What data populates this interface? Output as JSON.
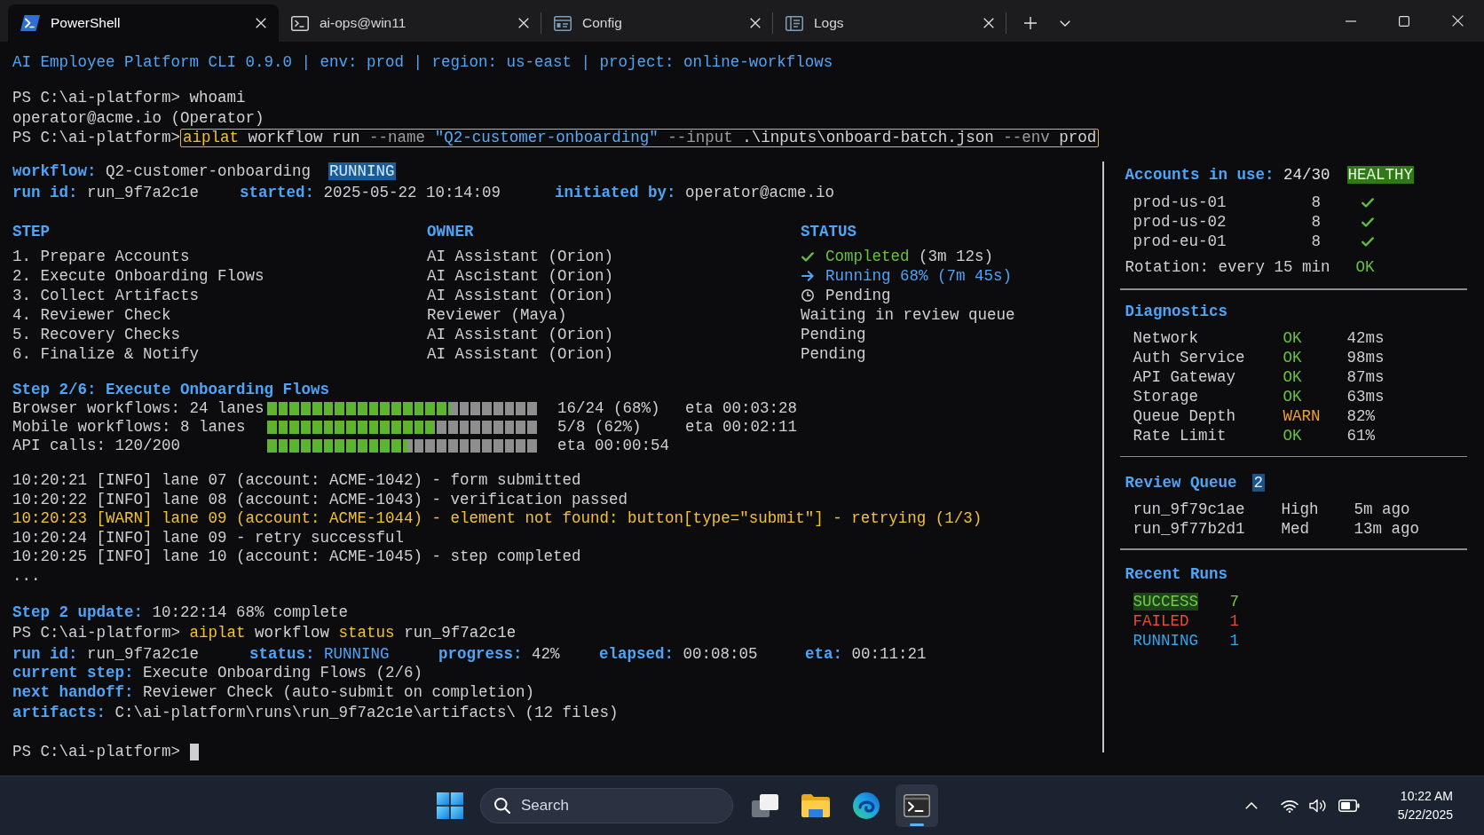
{
  "tabs": [
    {
      "label": "PowerShell",
      "selected": true
    },
    {
      "label": "ai-ops@win11",
      "selected": false
    },
    {
      "label": "Config",
      "selected": false
    },
    {
      "label": "Logs",
      "selected": false
    }
  ],
  "terminal": {
    "banner": "AI Employee Platform CLI 0.9.0 | env: prod | region: us-east | project: online-workflows",
    "history": [
      {
        "kind": "command",
        "prompt": "PS C:\\ai-platform>",
        "outlined": false,
        "tokens": [
          {
            "text": "whoami",
            "kind": "plain"
          }
        ]
      },
      {
        "kind": "output",
        "text": "operator@acme.io (Operator)"
      },
      {
        "kind": "command",
        "prompt": "PS C:\\ai-platform>",
        "outlined": true,
        "tokens": [
          {
            "text": "aiplat",
            "kind": "highlight"
          },
          {
            "text": "workflow run",
            "kind": "plain"
          },
          {
            "text": "--name",
            "kind": "flag"
          },
          {
            "text": "\"Q2-customer-onboarding\"",
            "kind": "string"
          },
          {
            "text": "--input",
            "kind": "flag"
          },
          {
            "text": ".\\inputs\\onboard-batch.json",
            "kind": "plain"
          },
          {
            "text": "--env",
            "kind": "flag"
          },
          {
            "text": "prod",
            "kind": "plain"
          }
        ]
      }
    ],
    "workflow": {
      "label": "workflow:",
      "value": "Q2-customer-onboarding",
      "status": "RUNNING"
    },
    "run_fields": [
      {
        "label": "run id:",
        "value": "run_9f7a2c1e"
      },
      {
        "label": "started:",
        "value": "2025-05-22 10:14:09"
      },
      {
        "label": "initiated by:",
        "value": "operator@acme.io"
      }
    ],
    "steps": {
      "columns": [
        "STEP",
        "OWNER",
        "STATUS"
      ],
      "rows": [
        {
          "step": "1. Prepare Accounts",
          "owner": "AI Assistant (Orion)",
          "status": "Completed",
          "detail": "(3m 12s)",
          "kind": "done"
        },
        {
          "step": "2. Execute Onboarding Flows",
          "owner": "AI Ascistant (Orion)",
          "status": "Running 68% (7m 45s)",
          "kind": "active"
        },
        {
          "step": "3. Collect Artifacts",
          "owner": "AI Assistant (Orion)",
          "status": "Pending",
          "kind": "next"
        },
        {
          "step": "4. Reviewer Check",
          "owner": "Reviewer (Maya)",
          "status": "Waiting in review queue",
          "kind": "queued"
        },
        {
          "step": "5. Recovery Checks",
          "owner": "AI Assistant (Orion)",
          "status": "Pending",
          "kind": "queued"
        },
        {
          "step": "6. Finalize & Notify",
          "owner": "AI Assistant (Orion)",
          "status": "Pending",
          "kind": "queued"
        }
      ]
    },
    "progress": {
      "title": "Step 2/6: Execute Onboarding Flows",
      "bars": [
        {
          "label": "Browser workflows: 24 lanes",
          "level": 0.68,
          "count": "16/24 (68%)",
          "eta": "eta 00:03:28"
        },
        {
          "label": "Mobile workflows: 8 lanes",
          "level": 0.62,
          "count": "5/8 (62%)",
          "eta": "eta 00:02:11"
        },
        {
          "label": "API calls: 120/200",
          "level": 0.52,
          "eta": "eta 00:00:54"
        }
      ]
    },
    "log": [
      {
        "text": "10:20:21 [INFO] lane 07 (account: ACME-1042) - form submitted",
        "kind": "info"
      },
      {
        "text": "10:20:22 [INFO] lane 08 (account: ACME-1043) - verification passed",
        "kind": "info"
      },
      {
        "text": "10:20:23 [WARN] lane 09 (account: ACME-1044) - element not found: button[type=\"submit\"] - retrying (1/3)",
        "kind": "warn"
      },
      {
        "text": "10:20:24 [INFO] lane 09 - retry successful",
        "kind": "info"
      },
      {
        "text": "10:20:25 [INFO] lane 10 (account: ACME-1045) - step completed",
        "kind": "info"
      },
      {
        "text": "...",
        "kind": "info"
      }
    ],
    "update": {
      "label": "Step 2 update:",
      "value": "10:22:14 68% complete"
    },
    "status_command": {
      "prompt": "PS C:\\ai-platform>",
      "outlined": false,
      "tokens": [
        {
          "text": "aiplat",
          "kind": "highlight"
        },
        {
          "text": "workflow",
          "kind": "plain"
        },
        {
          "text": "status",
          "kind": "highlight"
        },
        {
          "text": "run_9f7a2c1e",
          "kind": "plain"
        }
      ]
    },
    "status_fields": [
      {
        "label": "run id:",
        "value": "run_9f7a2c1e",
        "kind": "plain"
      },
      {
        "label": "status:",
        "value": "RUNNING",
        "kind": "status"
      },
      {
        "label": "progress:",
        "value": "42%",
        "kind": "plain"
      },
      {
        "label": "elapsed:",
        "value": "00:08:05",
        "kind": "plain"
      },
      {
        "label": "eta:",
        "value": "00:11:21",
        "kind": "plain"
      }
    ],
    "details": [
      {
        "label": "current step:",
        "value": "Execute Onboarding Flows (2/6)"
      },
      {
        "label": "next handoff:",
        "value": "Reviewer Check (auto-submit on completion)"
      },
      {
        "label": "artifacts:",
        "value": "C:\\ai-platform\\runs\\run_9f7a2c1e\\artifacts\\ (12 files)"
      }
    ],
    "final_prompt": "PS C:\\ai-platform>"
  },
  "sidebar": {
    "accounts": {
      "label": "Accounts in use:",
      "value": "24/30",
      "badge": "HEALTHY",
      "rows": [
        {
          "name": "prod-us-01",
          "count": "8",
          "ok": true
        },
        {
          "name": "prod-us-02",
          "count": "8",
          "ok": true
        },
        {
          "name": "prod-eu-01",
          "count": "8",
          "ok": true
        }
      ],
      "rotation": {
        "text": "Rotation: every 15 min",
        "status": "OK"
      }
    },
    "diagnostics": {
      "title": "Diagnostics",
      "rows": [
        {
          "name": "Network",
          "status": "OK",
          "kind": "ok",
          "value": "42ms"
        },
        {
          "name": "Auth Service",
          "status": "OK",
          "kind": "ok",
          "value": "98ms"
        },
        {
          "name": "API Gateway",
          "status": "OK",
          "kind": "ok",
          "value": "87ms"
        },
        {
          "name": "Storage",
          "status": "OK",
          "kind": "ok",
          "value": "63ms"
        },
        {
          "name": "Queue Depth",
          "status": "WARN",
          "kind": "warn",
          "value": "82%"
        },
        {
          "name": "Rate Limit",
          "status": "OK",
          "kind": "ok",
          "value": "61%"
        }
      ]
    },
    "review_queue": {
      "title": "Review Queue",
      "count": "2",
      "items": [
        {
          "run": "run_9f79c1ae",
          "priority": "High",
          "age": "5m ago"
        },
        {
          "run": "run_9f77b2d1",
          "priority": "Med",
          "age": "13m ago"
        }
      ]
    },
    "recent_runs": {
      "title": "Recent Runs",
      "rows": [
        {
          "label": "SUCCESS",
          "count": "7",
          "kind": "success"
        },
        {
          "label": "FAILED",
          "count": "1",
          "kind": "failed"
        },
        {
          "label": "RUNNING",
          "count": "1",
          "kind": "running"
        }
      ]
    }
  },
  "taskbar": {
    "search": {
      "placeholder": "Search"
    },
    "apps": [
      {
        "selected": false
      },
      {
        "selected": false
      },
      {
        "selected": false
      },
      {
        "selected": true
      }
    ],
    "clock": {
      "time": "10:22 AM",
      "date": "5/22/2025"
    }
  }
}
